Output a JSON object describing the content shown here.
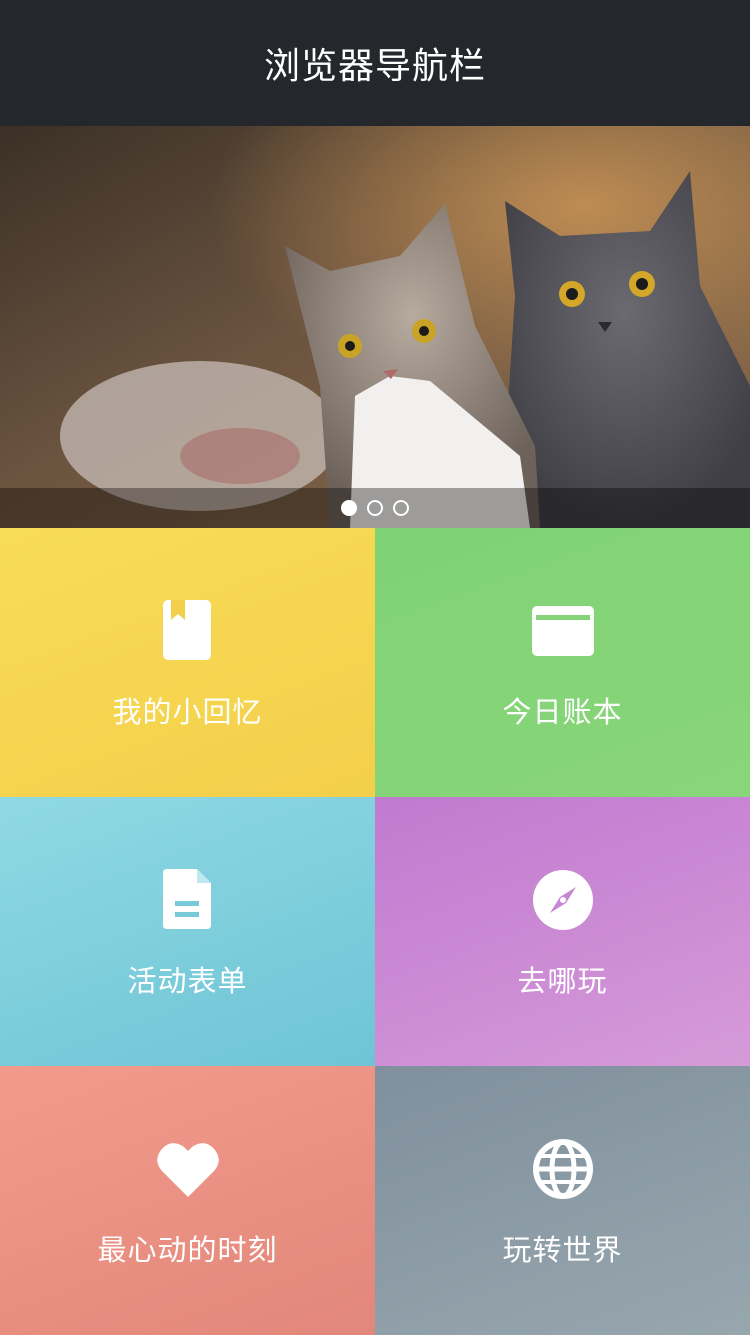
{
  "navbar": {
    "title": "浏览器导航栏"
  },
  "banner": {
    "slides_total": 3,
    "active_slide": 1
  },
  "tiles": [
    {
      "label": "我的小回忆",
      "icon": "bookmark-book-icon",
      "color": "#f7d54c"
    },
    {
      "label": "今日账本",
      "icon": "wallet-card-icon",
      "color": "#82d36e"
    },
    {
      "label": "活动表单",
      "icon": "document-form-icon",
      "color": "#7fd0dc"
    },
    {
      "label": "去哪玩",
      "icon": "compass-icon",
      "color": "#c889d6"
    },
    {
      "label": "最心动的时刻",
      "icon": "heart-icon",
      "color": "#ec8e7f"
    },
    {
      "label": "玩转世界",
      "icon": "globe-icon",
      "color": "#8a9aa6"
    }
  ]
}
